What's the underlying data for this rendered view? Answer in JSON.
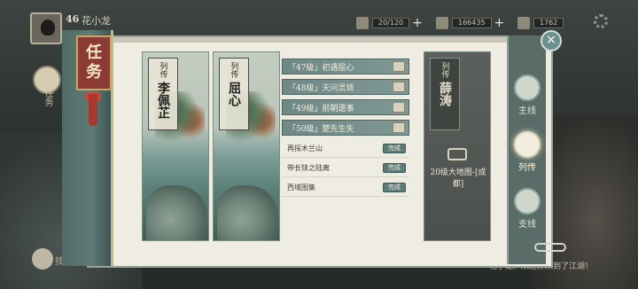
{
  "player": {
    "level": "46",
    "name": "花小龙"
  },
  "resources": [
    {
      "icon": "jade-icon",
      "value": "20/120"
    },
    {
      "icon": "coin-icon",
      "value": "166435"
    },
    {
      "icon": "ingot-icon",
      "value": "1762"
    }
  ],
  "panel": {
    "title_line1": "任",
    "title_line2": "务"
  },
  "hud": {
    "left_btn_label": "任务",
    "bottom_left_label": "技能",
    "chat_hint": "花小龙，欢迎你来到了江湖！"
  },
  "cards": [
    {
      "kind": "列传",
      "hero": "李佩芷",
      "locked": false
    },
    {
      "kind": "列传",
      "hero": "屈心",
      "locked": false
    },
    {
      "kind": "列传",
      "hero": "薛涛",
      "locked": true,
      "lock_text": "20级大地图-[成都]"
    }
  ],
  "quest_heads": [
    {
      "text": "「47级」初遇屈心"
    },
    {
      "text": "「48级」天问灵琐"
    },
    {
      "text": "「49级」前朝遗事"
    },
    {
      "text": "「50级」楚先生失"
    }
  ],
  "quest_rows": [
    {
      "text": "再探木兰山",
      "status": "完成"
    },
    {
      "text": "带长铗之陆离",
      "status": "完成"
    },
    {
      "text": "西域图集",
      "status": "完成"
    }
  ],
  "tabs": [
    {
      "label": "主线",
      "active": false
    },
    {
      "label": "列传",
      "active": true
    },
    {
      "label": "支线",
      "active": false
    }
  ],
  "close_label": "×"
}
